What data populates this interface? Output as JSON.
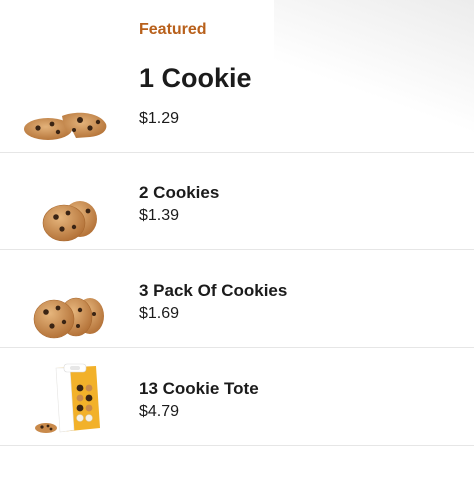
{
  "section": {
    "label": "Featured"
  },
  "items": [
    {
      "name": "1 Cookie",
      "price": "$1.29",
      "icon": "cookie-broken-icon"
    },
    {
      "name": "2 Cookies",
      "price": "$1.39",
      "icon": "cookie-pair-icon"
    },
    {
      "name": "3 Pack Of Cookies",
      "price": "$1.69",
      "icon": "cookie-stack-icon"
    },
    {
      "name": "13 Cookie Tote",
      "price": "$4.79",
      "icon": "cookie-tote-icon"
    }
  ],
  "colors": {
    "accent": "#b8601b",
    "text": "#1b1b1b",
    "divider": "#e6e6e6",
    "cookie": "#c98a4b",
    "tote": "#f2b12a"
  }
}
